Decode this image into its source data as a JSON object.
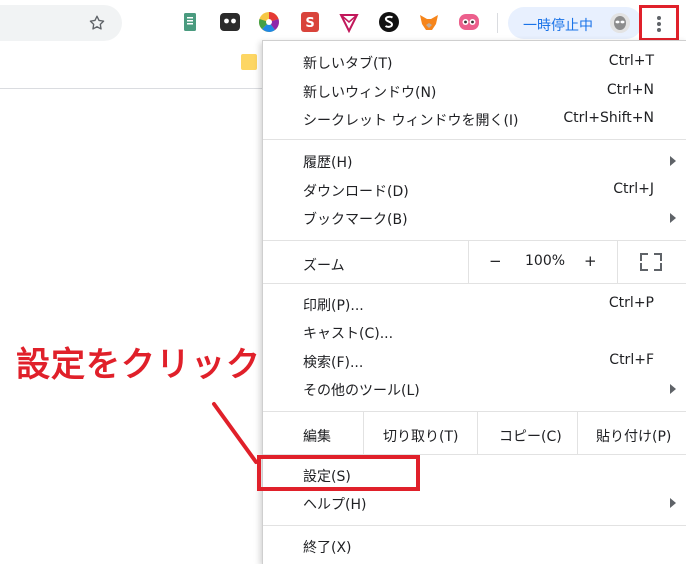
{
  "toolbar": {
    "pause_label": "一時停止中",
    "extensions": [
      "document-icon",
      "trello-icon",
      "color-wheel-icon",
      "s-app-icon",
      "triangle-icon",
      "s-logo-icon",
      "metamask-fox-icon",
      "face-icon"
    ]
  },
  "menu": {
    "new_tab": {
      "label": "新しいタブ(T)",
      "shortcut": "Ctrl+T"
    },
    "new_window": {
      "label": "新しいウィンドウ(N)",
      "shortcut": "Ctrl+N"
    },
    "incognito": {
      "label": "シークレット ウィンドウを開く(I)",
      "shortcut": "Ctrl+Shift+N"
    },
    "history": {
      "label": "履歴(H)"
    },
    "downloads": {
      "label": "ダウンロード(D)",
      "shortcut": "Ctrl+J"
    },
    "bookmarks": {
      "label": "ブックマーク(B)"
    },
    "zoom": {
      "label": "ズーム",
      "minus": "−",
      "value": "100%",
      "plus": "+"
    },
    "print": {
      "label": "印刷(P)...",
      "shortcut": "Ctrl+P"
    },
    "cast": {
      "label": "キャスト(C)..."
    },
    "find": {
      "label": "検索(F)...",
      "shortcut": "Ctrl+F"
    },
    "more_tools": {
      "label": "その他のツール(L)"
    },
    "edit": {
      "label": "編集",
      "cut": "切り取り(T)",
      "copy": "コピー(C)",
      "paste": "貼り付け(P)"
    },
    "settings": {
      "label": "設定(S)"
    },
    "help": {
      "label": "ヘルプ(H)"
    },
    "exit": {
      "label": "終了(X)"
    }
  },
  "annotation": {
    "callout": "設定をクリック",
    "color": "#e0202a"
  }
}
